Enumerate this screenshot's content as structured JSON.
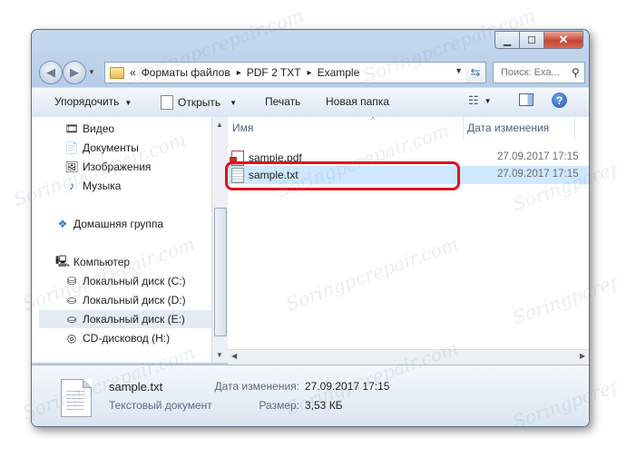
{
  "window": {
    "minimize": "▁",
    "maximize": "☐",
    "close": "✕"
  },
  "address": {
    "chevron": "«",
    "path": [
      "Форматы файлов",
      "PDF 2 TXT",
      "Example"
    ],
    "separator": "▸"
  },
  "search": {
    "placeholder": "Поиск: Exa..."
  },
  "toolbar": {
    "organize": "Упорядочить",
    "open": "Открыть",
    "print": "Печать",
    "new_folder": "Новая папка"
  },
  "nav": {
    "libraries": [
      "Видео",
      "Документы",
      "Изображения",
      "Музыка"
    ],
    "homegroup": "Домашняя группа",
    "computer": "Компьютер",
    "drives": [
      "Локальный диск (C:)",
      "Локальный диск (D:)",
      "Локальный диск (E:)",
      "CD-дисковод (H:)"
    ]
  },
  "columns": {
    "name": "Имя",
    "date": "Дата изменения"
  },
  "files": [
    {
      "name": "sample.pdf",
      "date": "27.09.2017 17:15",
      "icon": "pdf-icon"
    },
    {
      "name": "sample.txt",
      "date": "27.09.2017 17:15",
      "icon": "text-file-icon"
    }
  ],
  "details": {
    "filename": "sample.txt",
    "type": "Текстовый документ",
    "modified_label": "Дата изменения:",
    "modified_value": "27.09.2017 17:15",
    "size_label": "Размер:",
    "size_value": "3,53 КБ"
  },
  "watermark": "Soringpcrepair.com",
  "colors": {
    "highlight": "#e0121d",
    "selection": "#cde8ff"
  }
}
